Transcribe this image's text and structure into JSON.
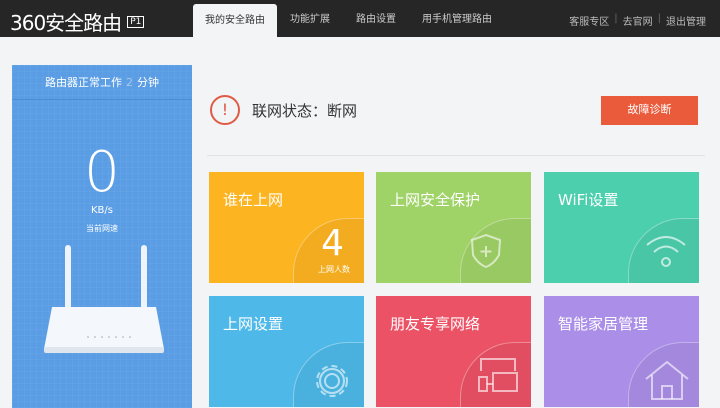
{
  "header": {
    "logo": "360安全路由",
    "model": "P1",
    "tabs": [
      "我的安全路由",
      "功能扩展",
      "路由设置",
      "用手机管理路由"
    ],
    "links": [
      "客服专区",
      "去官网",
      "退出管理"
    ]
  },
  "left": {
    "uptime_prefix": "路由器正常工作",
    "uptime_value": "2",
    "uptime_unit": "分钟",
    "speed": "0",
    "speed_unit": "KB/s",
    "speed_label": "当前网速"
  },
  "status": {
    "text": "联网状态：断网",
    "button": "故障诊断"
  },
  "tiles": [
    {
      "title": "谁在上网",
      "count": "4",
      "count_label": "上网人数",
      "color": "#fdb421"
    },
    {
      "title": "上网安全保护",
      "color": "#9fd267"
    },
    {
      "title": "WiFi设置",
      "color": "#4ccfad"
    },
    {
      "title": "上网设置",
      "color": "#4eb9e9"
    },
    {
      "title": "朋友专享网络",
      "color": "#ec5265"
    },
    {
      "title": "智能家居管理",
      "color": "#aa8ee8"
    }
  ]
}
